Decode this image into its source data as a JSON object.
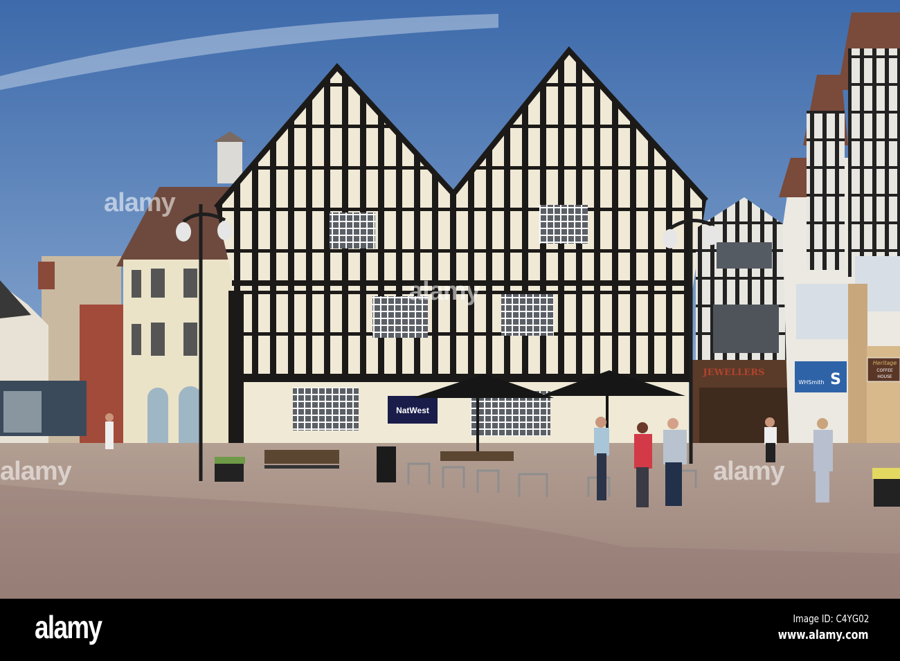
{
  "signs": {
    "bank": "NatWest",
    "jeweller": "JEWELLERS",
    "newsagent_logo": "S",
    "newsagent_name": "WHSmith",
    "coffee_line1": "Heritage",
    "coffee_line2": "COFFEE",
    "coffee_line3": "HOUSE"
  },
  "watermark": "alamy",
  "footer": {
    "logo": "alamy",
    "image_id": "Image ID: C4YG02",
    "url": "www.alamy.com"
  },
  "colors": {
    "sky_top": "#3d6aab",
    "sky_bottom": "#9ab6d8",
    "plaza": "#a38c84",
    "timber": "#1c1a18",
    "plaster": "#efe9d6"
  }
}
